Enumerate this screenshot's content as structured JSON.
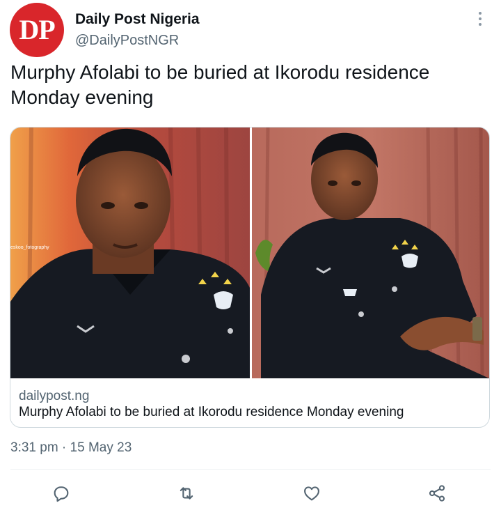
{
  "account": {
    "avatar_text": "DP",
    "display_name": "Daily Post Nigeria",
    "handle": "@DailyPostNGR"
  },
  "tweet": {
    "text": "Murphy Afolabi to be buried at Ikorodu residence Monday evening",
    "timestamp": "3:31 pm · 15 May 23"
  },
  "card": {
    "domain": "dailypost.ng",
    "title": "Murphy Afolabi to be buried at Ikorodu residence Monday evening",
    "photo_watermark": "eskoo_fotography"
  },
  "actions": [
    {
      "icon": "reply-icon"
    },
    {
      "icon": "retweet-icon"
    },
    {
      "icon": "like-icon"
    },
    {
      "icon": "share-icon"
    }
  ],
  "colors": {
    "brand_red": "#d9262b",
    "secondary_text": "#536471",
    "icon": "#536471",
    "border": "#cfd9de"
  }
}
